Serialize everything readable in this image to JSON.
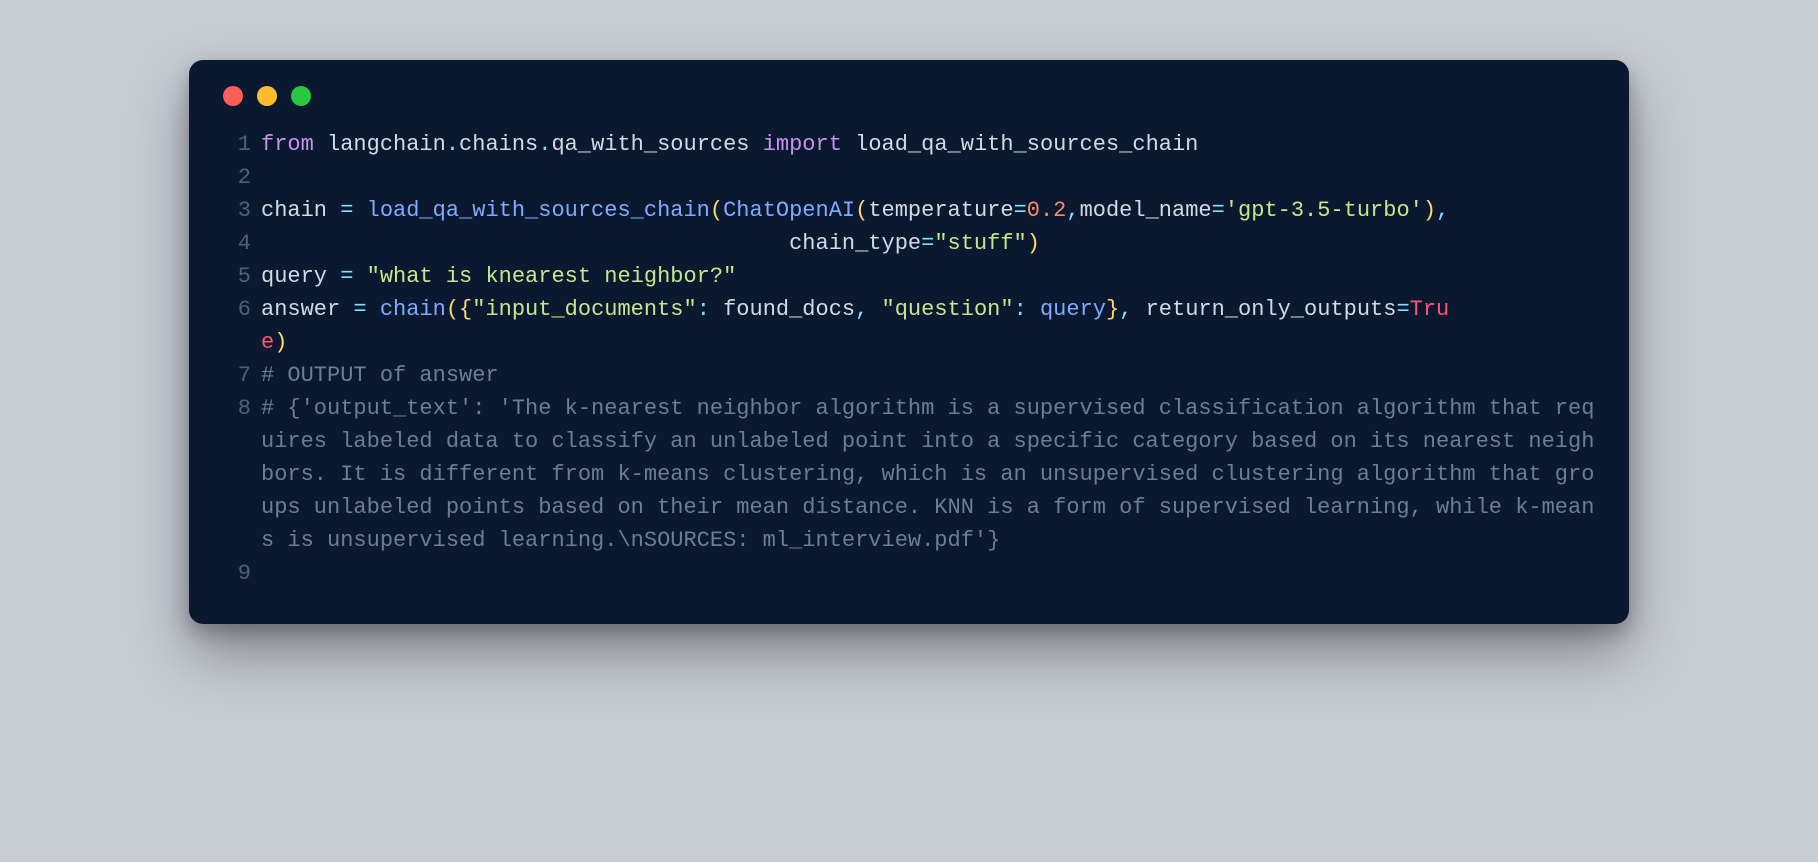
{
  "traffic": {
    "red": "#ff5f57",
    "yellow": "#febc2e",
    "green": "#28c840"
  },
  "gutter": {
    "l1": "1",
    "l2": "2",
    "l3": "3",
    "l4": "4",
    "l5": "5",
    "l6": "6",
    "l7": "7",
    "l8": "8",
    "l9": "9"
  },
  "line1": {
    "from": "from ",
    "module": "langchain",
    "dot1": ".",
    "sub1": "chains",
    "dot2": ".",
    "sub2": "qa_with_sources ",
    "import": "import ",
    "name": "load_qa_with_sources_chain"
  },
  "line3": {
    "lhs": "chain ",
    "eq": "= ",
    "call": "load_qa_with_sources_chain",
    "p1": "(",
    "cls": "ChatOpenAI",
    "p2": "(",
    "kw1": "temperature",
    "eq2": "=",
    "num": "0.2",
    "comma": ",",
    "kw2": "model_name",
    "eq3": "=",
    "str1": "'gpt-3.5-turbo'",
    "p3": ")",
    "comma2": ","
  },
  "line4": {
    "indent": "                                        ",
    "kw": "chain_type",
    "eq": "=",
    "str": "\"stuff\"",
    "p": ")"
  },
  "line5": {
    "lhs": "query ",
    "eq": "= ",
    "str": "\"what is knearest neighbor?\""
  },
  "line6": {
    "lhs": "answer ",
    "eq": "= ",
    "call": "chain",
    "p1": "(",
    "b1": "{",
    "k1": "\"input_documents\"",
    "colon1": ": ",
    "v1": "found_docs",
    "comma1": ", ",
    "k2": "\"question\"",
    "colon2": ": ",
    "v2": "query",
    "b2": "}",
    "comma2": ", ",
    "kw": "return_only_outputs",
    "eq2": "=",
    "const": "Tru"
  },
  "line6wrap": {
    "const2": "e",
    "p2": ")"
  },
  "line7": {
    "cmt": "# OUTPUT of answer"
  },
  "line8": {
    "cmt": "# {'output_text': 'The k-nearest neighbor algorithm is a supervised classification algorithm that requires labeled data to classify an unlabeled point into a specific category based on its nearest neighbors. It is different from k-means clustering, which is an unsupervised clustering algorithm that groups unlabeled points based on their mean distance. KNN is a form of supervised learning, while k-means is unsupervised learning.\\nSOURCES: ml_interview.pdf'}"
  }
}
